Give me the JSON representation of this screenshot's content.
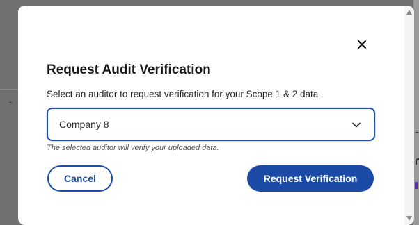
{
  "dialog": {
    "title": "Request Audit Verification",
    "description": "Select an auditor to request verification for your Scope 1 & 2 data",
    "close_icon": "close-icon"
  },
  "auditor_select": {
    "selected_value": "Company 8",
    "chevron_icon": "chevron-down-icon",
    "helper_text": "The selected auditor will verify your uploaded data."
  },
  "actions": {
    "cancel_label": "Cancel",
    "submit_label": "Request Verification"
  },
  "colors": {
    "primary": "#1a4aa6",
    "overlay": "#6f7070",
    "surface": "#ffffff"
  }
}
